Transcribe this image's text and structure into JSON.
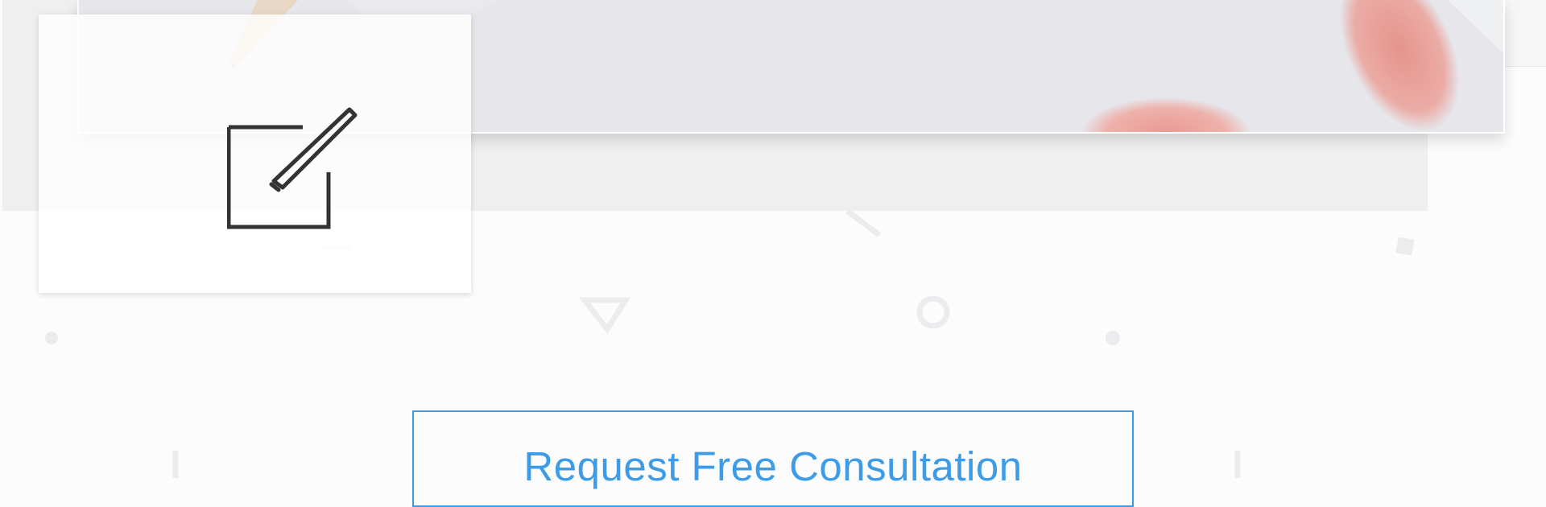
{
  "cta": {
    "label": "Request Free Consultation"
  },
  "feature_card": {
    "icon": "edit-icon"
  },
  "colors": {
    "accent": "#3d9ce8",
    "icon": "#333333",
    "band": "#efefef"
  }
}
